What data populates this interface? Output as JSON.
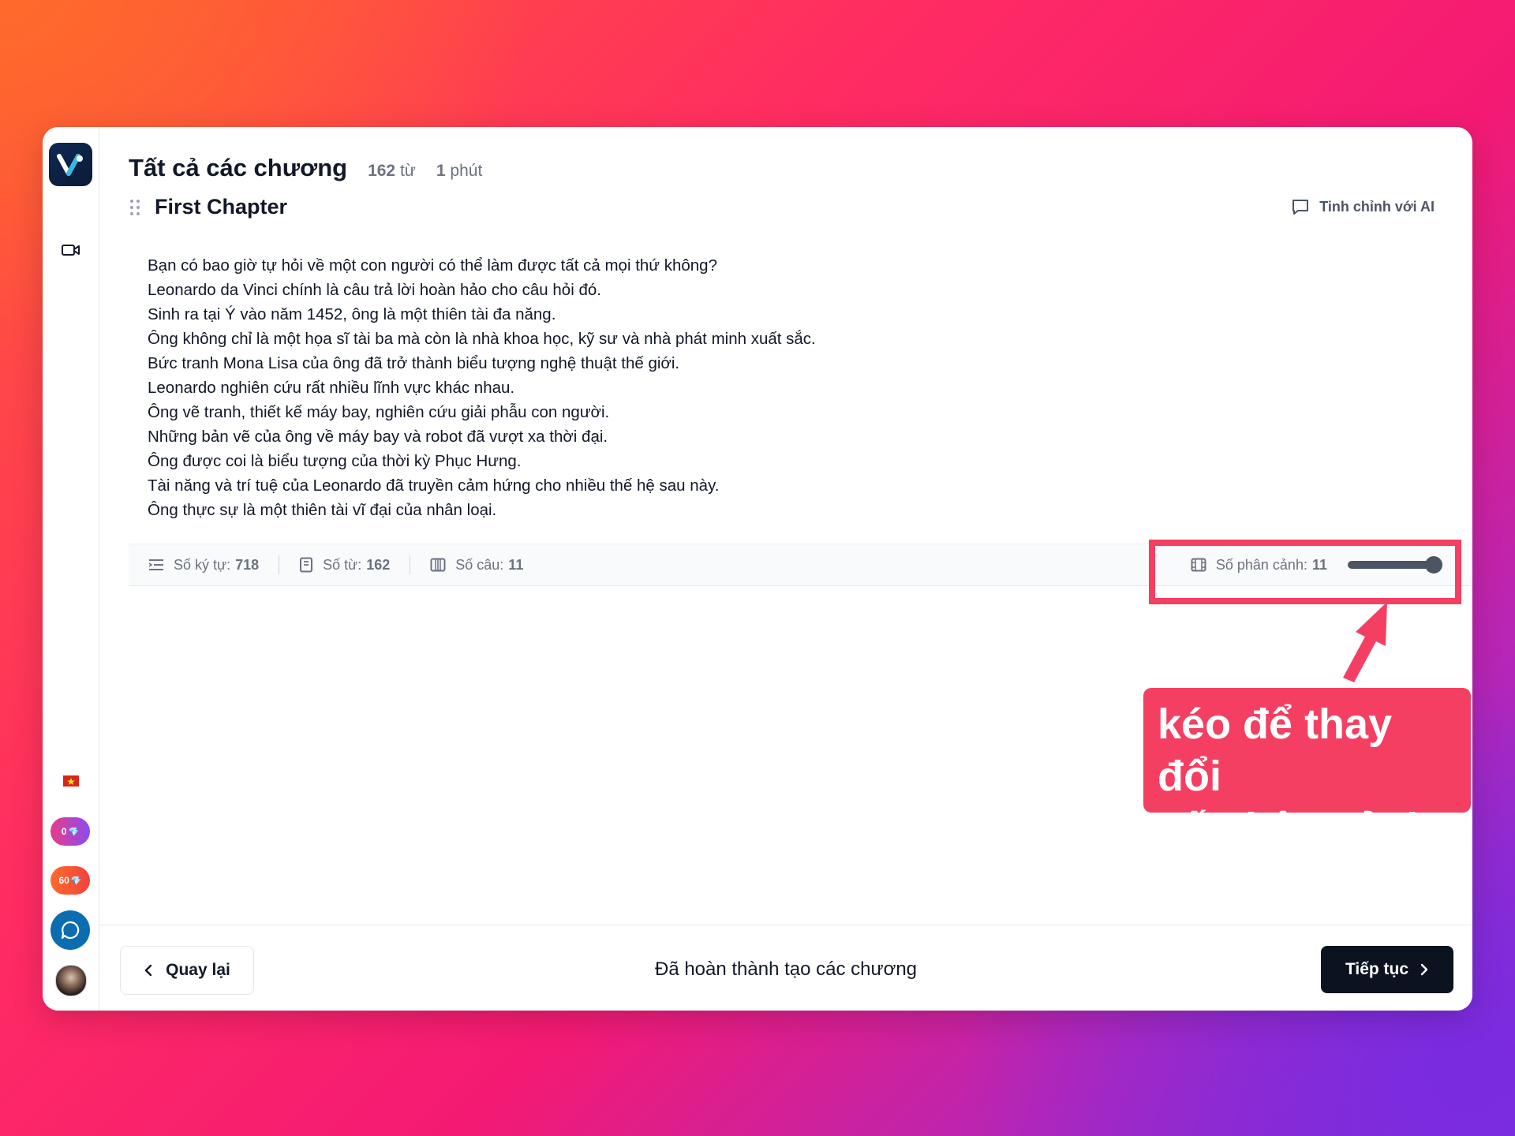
{
  "header": {
    "title": "Tất cả các chương",
    "word_count_value": "162",
    "word_count_unit": "từ",
    "duration_value": "1",
    "duration_unit": "phút"
  },
  "chapter": {
    "title": "First Chapter",
    "refine_label": "Tinh chỉnh với AI",
    "lines": [
      "Bạn có bao giờ tự hỏi về một con người có thể làm được tất cả mọi thứ không?",
      "Leonardo da Vinci chính là câu trả lời hoàn hảo cho câu hỏi đó.",
      "Sinh ra tại Ý vào năm 1452, ông là một thiên tài đa năng.",
      "Ông không chỉ là một họa sĩ tài ba mà còn là nhà khoa học, kỹ sư và nhà phát minh xuất sắc.",
      "Bức tranh Mona Lisa của ông đã trở thành biểu tượng nghệ thuật thế giới.",
      "Leonardo nghiên cứu rất nhiều lĩnh vực khác nhau.",
      "Ông vẽ tranh, thiết kế máy bay, nghiên cứu giải phẫu con người.",
      "Những bản vẽ của ông về máy bay và robot đã vượt xa thời đại.",
      "Ông được coi là biểu tượng của thời kỳ Phục Hưng.",
      "Tài năng và trí tuệ của Leonardo đã truyền cảm hứng cho nhiều thế hệ sau này.",
      "Ông thực sự là một thiên tài vĩ đại của nhân loại."
    ]
  },
  "stats": {
    "chars_label": "Số ký tự:",
    "chars_value": "718",
    "words_label": "Số từ:",
    "words_value": "162",
    "sentences_label": "Số câu:",
    "sentences_value": "11",
    "scenes_label": "Số phân cảnh:",
    "scenes_value": "11",
    "scenes_slider_fraction": 1.0
  },
  "sidebar": {
    "badge_purple": "0",
    "badge_orange": "60"
  },
  "footer": {
    "back_label": "Quay lại",
    "status_text": "Đã hoàn thành tạo các chương",
    "next_label": "Tiếp tục"
  },
  "annotation": {
    "line1": "kéo để thay đổi",
    "line2": "số phân cảnh"
  },
  "colors": {
    "accent_red": "#f43f62",
    "next_button": "#0b1320",
    "chat_button": "#0b6db0"
  }
}
